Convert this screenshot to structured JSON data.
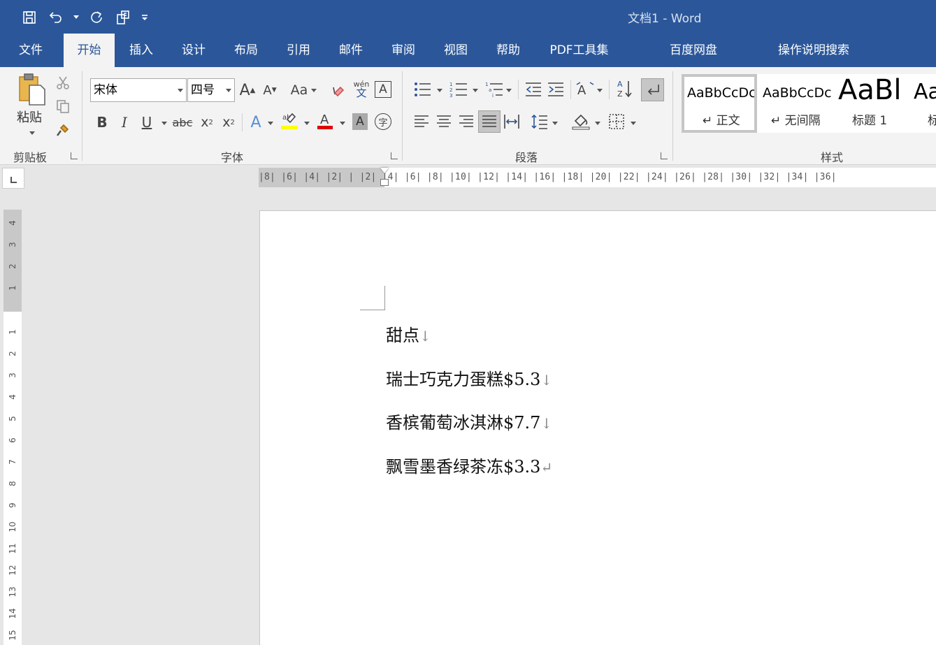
{
  "window": {
    "title": "文档1  -  Word"
  },
  "quick_access": {
    "icons": [
      "save-icon",
      "undo-icon",
      "redo-icon",
      "touch-mode-icon",
      "customize-icon"
    ]
  },
  "tabs": [
    {
      "label": "文件"
    },
    {
      "label": "开始"
    },
    {
      "label": "插入"
    },
    {
      "label": "设计"
    },
    {
      "label": "布局"
    },
    {
      "label": "引用"
    },
    {
      "label": "邮件"
    },
    {
      "label": "审阅"
    },
    {
      "label": "视图"
    },
    {
      "label": "帮助"
    },
    {
      "label": "PDF工具集"
    },
    {
      "label": "百度网盘"
    },
    {
      "label": "操作说明搜索"
    }
  ],
  "active_tab": "开始",
  "clipboard": {
    "paste_label": "粘贴",
    "group_label": "剪贴板"
  },
  "font": {
    "name": "宋体",
    "size": "四号",
    "group_label": "字体",
    "change_case": "Aa",
    "phonetic_top": "wén",
    "phonetic_bottom": "文",
    "border_char": "A",
    "bold": "B",
    "italic": "I",
    "underline": "U",
    "strike": "abc",
    "sub": "x",
    "sup": "x",
    "highlight_color": "#ffff00",
    "font_color": "#e00000",
    "enclose_char": "字"
  },
  "paragraph": {
    "group_label": "段落"
  },
  "styles": {
    "group_label": "样式",
    "items": [
      {
        "sample": "AaBbCcDc",
        "name": "↵ 正文"
      },
      {
        "sample": "AaBbCcDc",
        "name": "↵ 无间隔"
      },
      {
        "sample": "AaBl",
        "name": "标题 1"
      },
      {
        "sample": "Aa",
        "name": "标"
      }
    ]
  },
  "ruler": {
    "horizontal": "|8|  |6|  |4|  |2|   |   |2|  |4|  |6|  |8|  |10|  |12|  |14|  |16|  |18|  |20|  |22|  |24|  |26|  |28|  |30|  |32|  |34|  |36|",
    "vertical_above": [
      "4",
      "3",
      "2",
      "1"
    ],
    "vertical_below": [
      "1",
      "2",
      "3",
      "4",
      "5",
      "6",
      "7",
      "8",
      "9",
      "10",
      "11",
      "12",
      "13",
      "14",
      "15"
    ]
  },
  "document": {
    "paragraphs": [
      {
        "text": "甜点",
        "mark": "↓"
      },
      {
        "text": "瑞士巧克力蛋糕$5.3",
        "mark": "↓"
      },
      {
        "text": "香槟葡萄冰淇淋$7.7",
        "mark": "↓"
      },
      {
        "text": "飘雪墨香绿茶冻$3.3",
        "mark": "↵"
      }
    ]
  }
}
